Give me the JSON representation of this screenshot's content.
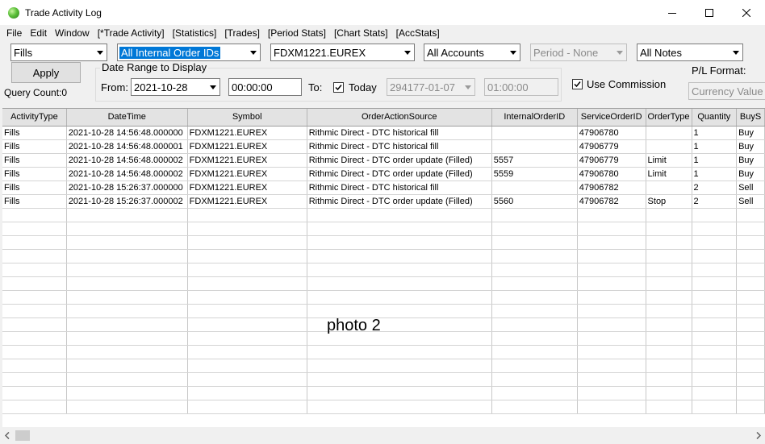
{
  "window": {
    "title": "Trade Activity Log"
  },
  "menu": [
    "File",
    "Edit",
    "Window",
    "[*Trade Activity]",
    "[Statistics]",
    "[Trades]",
    "[Period Stats]",
    "[Chart Stats]",
    "[AccStats]"
  ],
  "filters": {
    "activity_type": "Fills",
    "order_ids": "All Internal Order IDs",
    "symbol": "FDXM1221.EUREX",
    "accounts": "All Accounts",
    "period": "Period - None",
    "notes": "All Notes"
  },
  "apply_label": "Apply",
  "query_count": "Query Count:0",
  "date_range": {
    "title": "Date Range to Display",
    "from_label": "From:",
    "from_date": "2021-10-28",
    "from_time": "00:00:00",
    "to_label": "To:",
    "today_label": "Today",
    "to_date": "294177-01-07",
    "to_time": "01:00:00"
  },
  "use_commission_label": "Use Commission",
  "pl_format": {
    "label": "P/L Format:",
    "placeholder": "Currency Value"
  },
  "table": {
    "columns": [
      "ActivityType",
      "DateTime",
      "Symbol",
      "OrderActionSource",
      "InternalOrderID",
      "ServiceOrderID",
      "OrderType",
      "Quantity",
      "BuyS"
    ],
    "rows": [
      [
        "Fills",
        "2021-10-28  14:56:48.000000",
        "FDXM1221.EUREX",
        "Rithmic Direct - DTC historical fill",
        "",
        "47906780",
        "",
        "1",
        "Buy"
      ],
      [
        "Fills",
        "2021-10-28  14:56:48.000001",
        "FDXM1221.EUREX",
        "Rithmic Direct - DTC historical fill",
        "",
        "47906779",
        "",
        "1",
        "Buy"
      ],
      [
        "Fills",
        "2021-10-28  14:56:48.000002",
        "FDXM1221.EUREX",
        "Rithmic Direct - DTC order update (Filled)",
        "5557",
        "47906779",
        "Limit",
        "1",
        "Buy"
      ],
      [
        "Fills",
        "2021-10-28  14:56:48.000002",
        "FDXM1221.EUREX",
        "Rithmic Direct - DTC order update (Filled)",
        "5559",
        "47906780",
        "Limit",
        "1",
        "Buy"
      ],
      [
        "Fills",
        "2021-10-28  15:26:37.000000",
        "FDXM1221.EUREX",
        "Rithmic Direct - DTC historical fill",
        "",
        "47906782",
        "",
        "2",
        "Sell"
      ],
      [
        "Fills",
        "2021-10-28  15:26:37.000002",
        "FDXM1221.EUREX",
        "Rithmic Direct - DTC order update (Filled)",
        "5560",
        "47906782",
        "Stop",
        "2",
        "Sell"
      ]
    ]
  },
  "overlay_text": "photo 2"
}
